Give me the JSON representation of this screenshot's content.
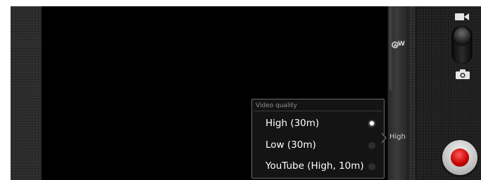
{
  "camera": {
    "popup": {
      "title": "Video quality",
      "options": [
        {
          "label": "High (30m)",
          "selected": true
        },
        {
          "label": "Low (30m)",
          "selected": false
        },
        {
          "label": "YouTube (High, 10m)",
          "selected": false
        }
      ]
    },
    "side_strip": {
      "white_balance_icon_text": "W",
      "current_quality": "High"
    },
    "controls": {
      "mode_switch": "video",
      "shutter_color": "#d40000"
    },
    "icons": {
      "video": "video-camera-icon",
      "photo": "photo-camera-icon",
      "white_balance": "white-balance-auto-icon"
    }
  }
}
